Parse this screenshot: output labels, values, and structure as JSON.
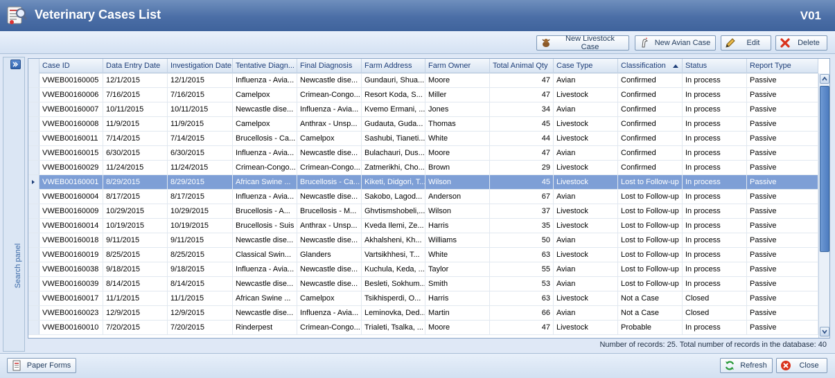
{
  "window": {
    "title": "Veterinary Cases List",
    "code": "V01"
  },
  "toolbar": {
    "new_livestock": "New Livestock Case",
    "new_avian": "New Avian Case",
    "edit": "Edit",
    "delete": "Delete"
  },
  "search_panel": {
    "label": "Search panel"
  },
  "grid": {
    "columns": [
      "Case ID",
      "Data Entry Date",
      "Investigation Date",
      "Tentative Diagn...",
      "Final Diagnosis",
      "Farm Address",
      "Farm Owner",
      "Total Animal Qty",
      "Case Type",
      "Classification",
      "Status",
      "Report Type"
    ],
    "sorted_column": "Classification",
    "sort_direction": "ascending",
    "selected_row": 7,
    "rows": [
      [
        "VWEB00160005",
        "12/1/2015",
        "12/1/2015",
        "Influenza - Avia...",
        "Newcastle dise...",
        "Gundauri, Shua...",
        "Moore",
        "47",
        "Avian",
        "Confirmed",
        "In process",
        "Passive"
      ],
      [
        "VWEB00160006",
        "7/16/2015",
        "7/16/2015",
        "Camelpox",
        "Crimean-Congo...",
        "Resort Koda, S...",
        "Miller",
        "47",
        "Livestock",
        "Confirmed",
        "In process",
        "Passive"
      ],
      [
        "VWEB00160007",
        "10/11/2015",
        "10/11/2015",
        "Newcastle dise...",
        "Influenza - Avia...",
        "Kvemo Ermani, ...",
        "Jones",
        "34",
        "Avian",
        "Confirmed",
        "In process",
        "Passive"
      ],
      [
        "VWEB00160008",
        "11/9/2015",
        "11/9/2015",
        "Camelpox",
        "Anthrax - Unsp...",
        "Gudauta, Guda...",
        "Thomas",
        "45",
        "Livestock",
        "Confirmed",
        "In process",
        "Passive"
      ],
      [
        "VWEB00160011",
        "7/14/2015",
        "7/14/2015",
        "Brucellosis - Ca...",
        "Camelpox",
        "Sashubi, Tianeti...",
        "White",
        "44",
        "Livestock",
        "Confirmed",
        "In process",
        "Passive"
      ],
      [
        "VWEB00160015",
        "6/30/2015",
        "6/30/2015",
        "Influenza - Avia...",
        "Newcastle dise...",
        "Bulachauri, Dus...",
        "Moore",
        "47",
        "Avian",
        "Confirmed",
        "In process",
        "Passive"
      ],
      [
        "VWEB00160029",
        "11/24/2015",
        "11/24/2015",
        "Crimean-Congo...",
        "Crimean-Congo...",
        "Zatmerikhi, Cho...",
        "Brown",
        "29",
        "Livestock",
        "Confirmed",
        "In process",
        "Passive"
      ],
      [
        "VWEB00160001",
        "8/29/2015",
        "8/29/2015",
        "African Swine ...",
        "Brucellosis - Ca...",
        "Kiketi, Didgori, T...",
        "Wilson",
        "45",
        "Livestock",
        "Lost to Follow-up",
        "In process",
        "Passive"
      ],
      [
        "VWEB00160004",
        "8/17/2015",
        "8/17/2015",
        "Influenza - Avia...",
        "Newcastle dise...",
        "Sakobo, Lagod...",
        "Anderson",
        "67",
        "Avian",
        "Lost to Follow-up",
        "In process",
        "Passive"
      ],
      [
        "VWEB00160009",
        "10/29/2015",
        "10/29/2015",
        "Brucellosis - A...",
        "Brucellosis - M...",
        "Ghvtismshobeli,...",
        "Wilson",
        "37",
        "Livestock",
        "Lost to Follow-up",
        "In process",
        "Passive"
      ],
      [
        "VWEB00160014",
        "10/19/2015",
        "10/19/2015",
        "Brucellosis - Suis",
        "Anthrax - Unsp...",
        "Kveda Ilemi, Ze...",
        "Harris",
        "35",
        "Livestock",
        "Lost to Follow-up",
        "In process",
        "Passive"
      ],
      [
        "VWEB00160018",
        "9/11/2015",
        "9/11/2015",
        "Newcastle dise...",
        "Newcastle dise...",
        "Akhalsheni, Kh...",
        "Williams",
        "50",
        "Avian",
        "Lost to Follow-up",
        "In process",
        "Passive"
      ],
      [
        "VWEB00160019",
        "8/25/2015",
        "8/25/2015",
        "Classical Swin...",
        "Glanders",
        "Vartsikhhesi, T...",
        "White",
        "63",
        "Livestock",
        "Lost to Follow-up",
        "In process",
        "Passive"
      ],
      [
        "VWEB00160038",
        "9/18/2015",
        "9/18/2015",
        "Influenza - Avia...",
        "Newcastle dise...",
        "Kuchula, Keda, ...",
        "Taylor",
        "55",
        "Avian",
        "Lost to Follow-up",
        "In process",
        "Passive"
      ],
      [
        "VWEB00160039",
        "8/14/2015",
        "8/14/2015",
        "Newcastle dise...",
        "Newcastle dise...",
        "Besleti, Sokhum...",
        "Smith",
        "53",
        "Avian",
        "Lost to Follow-up",
        "In process",
        "Passive"
      ],
      [
        "VWEB00160017",
        "11/1/2015",
        "11/1/2015",
        "African Swine ...",
        "Camelpox",
        "Tsikhisperdi, O...",
        "Harris",
        "63",
        "Livestock",
        "Not a Case",
        "Closed",
        "Passive"
      ],
      [
        "VWEB00160023",
        "12/9/2015",
        "12/9/2015",
        "Newcastle dise...",
        "Influenza - Avia...",
        "Leminovka, Ded...",
        "Martin",
        "66",
        "Avian",
        "Not a Case",
        "Closed",
        "Passive"
      ],
      [
        "VWEB00160010",
        "7/20/2015",
        "7/20/2015",
        "Rinderpest",
        "Crimean-Congo...",
        "Trialeti, Tsalka, ...",
        "Moore",
        "47",
        "Livestock",
        "Probable",
        "In process",
        "Passive"
      ]
    ]
  },
  "footer": {
    "records_text": "Number of records: 25. Total number of records in the database: 40"
  },
  "bottombar": {
    "paper_forms": "Paper Forms",
    "refresh": "Refresh",
    "close": "Close"
  },
  "colors": {
    "title_bg": "#4b6ea6",
    "selected_row": "#7e9fd6",
    "header_text": "#1e3e78"
  }
}
